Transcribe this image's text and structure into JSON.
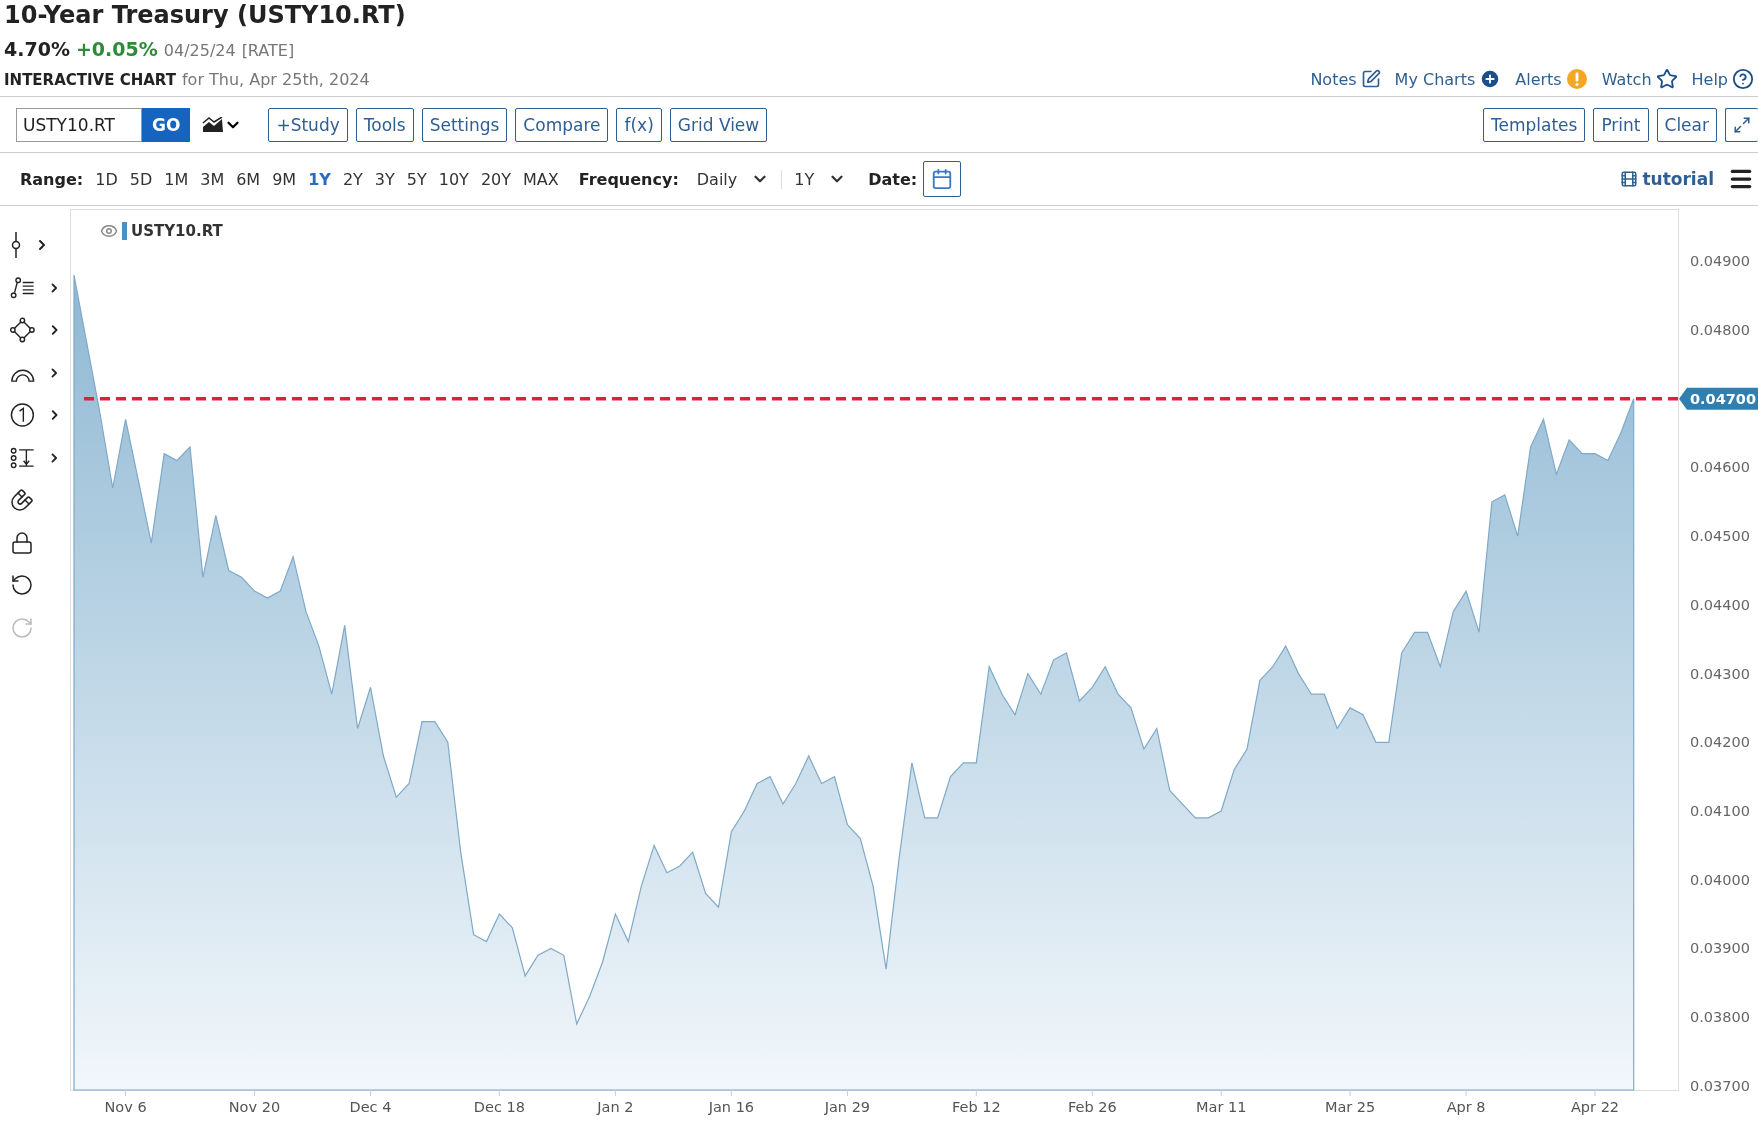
{
  "header": {
    "title": "10-Year Treasury (USTY10.RT)",
    "price": "4.70%",
    "change": "+0.05%",
    "date": "04/25/24",
    "type_tag": "[RATE]"
  },
  "subtitle": {
    "label": "INTERACTIVE CHART",
    "text": "for Thu, Apr 25th, 2024"
  },
  "links": [
    {
      "kind": "notes",
      "label": "Notes"
    },
    {
      "kind": "add",
      "label": "My Charts"
    },
    {
      "kind": "alert",
      "label": "Alerts"
    },
    {
      "kind": "star",
      "label": "Watch"
    },
    {
      "kind": "help",
      "label": "Help"
    }
  ],
  "toolbar": {
    "symbol": "USTY10.RT",
    "go": "GO",
    "buttons": [
      "+Study",
      "Tools",
      "Settings",
      "Compare",
      "f(x)",
      "Grid View"
    ],
    "right_buttons": [
      "Templates",
      "Print",
      "Clear"
    ]
  },
  "range": {
    "label": "Range:",
    "options": [
      {
        "label": "1D",
        "selected": false
      },
      {
        "label": "5D",
        "selected": false
      },
      {
        "label": "1M",
        "selected": false
      },
      {
        "label": "3M",
        "selected": false
      },
      {
        "label": "6M",
        "selected": false
      },
      {
        "label": "9M",
        "selected": false
      },
      {
        "label": "1Y",
        "selected": true
      },
      {
        "label": "2Y",
        "selected": false
      },
      {
        "label": "3Y",
        "selected": false
      },
      {
        "label": "5Y",
        "selected": false
      },
      {
        "label": "10Y",
        "selected": false
      },
      {
        "label": "20Y",
        "selected": false
      },
      {
        "label": "MAX",
        "selected": false
      }
    ]
  },
  "frequency": {
    "label": "Frequency:",
    "value": "Daily"
  },
  "period": {
    "value": "1Y"
  },
  "date": {
    "label": "Date:"
  },
  "tutorial": "tutorial",
  "tools": [
    {
      "kind": "crosshair",
      "menu": true,
      "disabled": false
    },
    {
      "kind": "lines",
      "menu": true,
      "disabled": false
    },
    {
      "kind": "shape",
      "menu": true,
      "disabled": false
    },
    {
      "kind": "arc",
      "menu": true,
      "disabled": false
    },
    {
      "kind": "number",
      "menu": true,
      "disabled": false
    },
    {
      "kind": "measure",
      "menu": true,
      "disabled": false
    },
    {
      "kind": "magnet",
      "menu": false,
      "disabled": false
    },
    {
      "kind": "lock",
      "menu": false,
      "disabled": false
    },
    {
      "kind": "undo",
      "menu": false,
      "disabled": false
    },
    {
      "kind": "redo",
      "menu": false,
      "disabled": true
    }
  ],
  "chart": {
    "chart_data": {
      "type": "area",
      "categories": [
        null,
        null,
        null,
        null,
        "Nov 6",
        null,
        null,
        null,
        null,
        null,
        null,
        null,
        null,
        null,
        "Nov 20",
        null,
        null,
        null,
        null,
        null,
        null,
        null,
        null,
        "Dec 4",
        null,
        null,
        null,
        null,
        null,
        null,
        null,
        null,
        null,
        "Dec 18",
        null,
        null,
        null,
        null,
        null,
        null,
        null,
        null,
        "Jan 2",
        null,
        null,
        null,
        null,
        null,
        null,
        null,
        null,
        "Jan 16",
        null,
        null,
        null,
        null,
        null,
        null,
        null,
        null,
        "Jan 29",
        null,
        null,
        null,
        null,
        null,
        null,
        null,
        null,
        null,
        "Feb 12",
        null,
        null,
        null,
        null,
        null,
        null,
        null,
        null,
        "Feb 26",
        null,
        null,
        null,
        null,
        null,
        null,
        null,
        null,
        null,
        "Mar 11",
        null,
        null,
        null,
        null,
        null,
        null,
        null,
        null,
        null,
        "Mar 25",
        null,
        null,
        null,
        null,
        null,
        null,
        null,
        null,
        "Apr 8",
        null,
        null,
        null,
        null,
        null,
        null,
        null,
        null,
        null,
        "Apr 22",
        null,
        null,
        null
      ],
      "series": [
        {
          "name": "USTY10.RT",
          "color": "#8fb8d3",
          "values": [
            0.0488,
            0.0478,
            0.0468,
            0.0457,
            0.0467,
            0.0458,
            0.0449,
            0.0462,
            0.0461,
            0.0463,
            0.0444,
            0.0453,
            0.0445,
            0.0444,
            0.0442,
            0.0441,
            0.0442,
            0.0447,
            0.0439,
            0.0434,
            0.0427,
            0.0437,
            0.0422,
            0.0428,
            0.0418,
            0.0412,
            0.0414,
            0.0423,
            0.0423,
            0.042,
            0.0404,
            0.0392,
            0.0391,
            0.0395,
            0.0393,
            0.0386,
            0.0389,
            0.039,
            0.0389,
            0.0379,
            0.0383,
            0.0388,
            0.0395,
            0.0391,
            0.0399,
            0.0405,
            0.0401,
            0.0402,
            0.0404,
            0.0398,
            0.0396,
            0.0407,
            0.041,
            0.0414,
            0.0415,
            0.0411,
            0.0414,
            0.0418,
            0.0414,
            0.0415,
            0.0408,
            0.0406,
            0.0399,
            0.0387,
            0.0403,
            0.0417,
            0.0409,
            0.0409,
            0.0415,
            0.0417,
            0.0417,
            0.0431,
            0.0427,
            0.0424,
            0.043,
            0.0427,
            0.0432,
            0.0433,
            0.0426,
            0.0428,
            0.0431,
            0.0427,
            0.0425,
            0.0419,
            0.0422,
            0.0413,
            0.0411,
            0.0409,
            0.0409,
            0.041,
            0.0416,
            0.0419,
            0.0429,
            0.0431,
            0.0434,
            0.043,
            0.0427,
            0.0427,
            0.0422,
            0.0425,
            0.0424,
            0.042,
            0.042,
            0.0433,
            0.0436,
            0.0436,
            0.0431,
            0.0439,
            0.0442,
            0.0436,
            0.0455,
            0.0456,
            0.045,
            0.0463,
            0.0467,
            0.0459,
            0.0464,
            0.0462,
            0.0462,
            0.0461,
            0.0465,
            0.047
          ]
        }
      ],
      "ylim": [
        0.03694,
        0.04976
      ],
      "yticks": [
        {
          "value": 0.049,
          "label": "0.04900"
        },
        {
          "value": 0.048,
          "label": "0.04800"
        },
        {
          "value": 0.046,
          "label": "0.04600"
        },
        {
          "value": 0.045,
          "label": "0.04500"
        },
        {
          "value": 0.044,
          "label": "0.04400"
        },
        {
          "value": 0.043,
          "label": "0.04300"
        },
        {
          "value": 0.042,
          "label": "0.04200"
        },
        {
          "value": 0.041,
          "label": "0.04100"
        },
        {
          "value": 0.04,
          "label": "0.04000"
        },
        {
          "value": 0.039,
          "label": "0.03900"
        },
        {
          "value": 0.038,
          "label": "0.03800"
        },
        {
          "value": 0.037,
          "label": "0.03700"
        }
      ],
      "ref_lines": [
        {
          "axis": "y",
          "value": 0.047,
          "label": "0.04700",
          "color": "#e0203a"
        }
      ]
    }
  }
}
